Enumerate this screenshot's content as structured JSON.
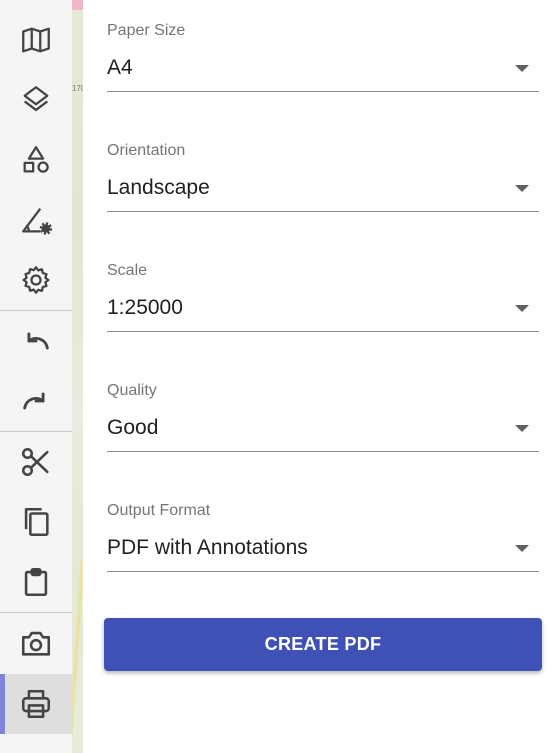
{
  "toolbar": {
    "items": [
      {
        "icon": "map-icon"
      },
      {
        "icon": "layers-icon"
      },
      {
        "icon": "shapes-icon"
      },
      {
        "icon": "measure-settings-icon"
      },
      {
        "icon": "gear-icon"
      },
      {
        "icon": "undo-icon"
      },
      {
        "icon": "redo-icon"
      },
      {
        "icon": "scissors-icon"
      },
      {
        "icon": "copy-icon"
      },
      {
        "icon": "clipboard-icon"
      },
      {
        "icon": "camera-icon"
      },
      {
        "icon": "printer-icon",
        "active": true
      }
    ],
    "active_color": "#7f84d9"
  },
  "map": {
    "label": "170"
  },
  "print": {
    "fields": [
      {
        "label": "Paper Size",
        "value": "A4"
      },
      {
        "label": "Orientation",
        "value": "Landscape"
      },
      {
        "label": "Scale",
        "value": "1:25000"
      },
      {
        "label": "Quality",
        "value": "Good"
      },
      {
        "label": "Output Format",
        "value": "PDF with Annotations"
      }
    ],
    "create_label": "CREATE PDF",
    "button_color": "#3f51b5"
  }
}
